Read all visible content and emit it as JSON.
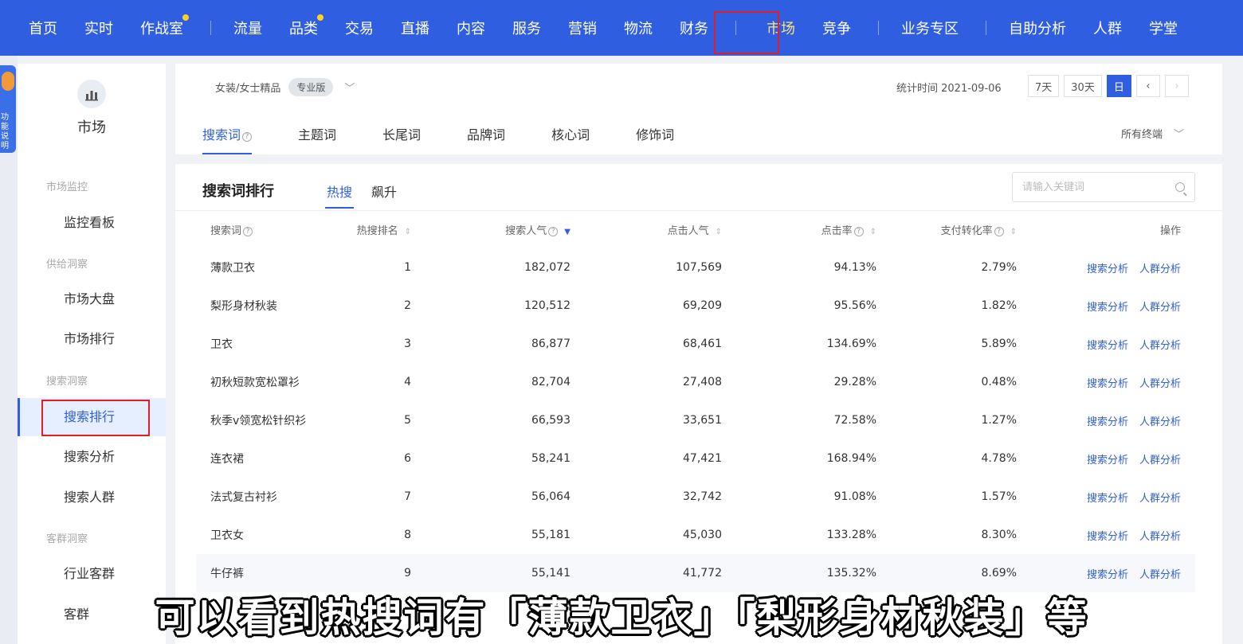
{
  "topnav": {
    "items": [
      "首页",
      "实时",
      "作战室",
      "流量",
      "品类",
      "交易",
      "直播",
      "内容",
      "服务",
      "营销",
      "物流",
      "财务",
      "市场",
      "竞争",
      "业务专区",
      "自助分析",
      "人群",
      "学堂"
    ],
    "active": "市场"
  },
  "mascot": {
    "text": "功能说明"
  },
  "sidebar": {
    "title": "市场",
    "group_monitor": "市场监控",
    "item_monitor_board": "监控看板",
    "group_supply": "供给洞察",
    "item_market_overview": "市场大盘",
    "item_market_rank": "市场排行",
    "group_search": "搜索洞察",
    "item_search_rank": "搜索排行",
    "item_search_analysis": "搜索分析",
    "item_search_crowd": "搜索人群",
    "group_customer": "客群洞察",
    "item_industry_crowd": "行业客群",
    "item_customer_partial": "客群"
  },
  "filter": {
    "category": "女装/女士精品",
    "edition": "专业版",
    "stat_time": "统计时间 2021-09-06",
    "range_7": "7天",
    "range_30": "30天",
    "range_day": "日",
    "prev": "‹",
    "next": "›",
    "tabs": [
      "搜索词",
      "主题词",
      "长尾词",
      "品牌词",
      "核心词",
      "修饰词"
    ],
    "terminal": "所有终端"
  },
  "ranking": {
    "title": "搜索词排行",
    "subtab_hot": "热搜",
    "subtab_rise": "飙升",
    "search_placeholder": "请输入关键词",
    "columns": [
      "搜索词",
      "热搜排名",
      "搜索人气",
      "点击人气",
      "点击率",
      "支付转化率",
      "操作"
    ],
    "link_search": "搜索分析",
    "link_crowd": "人群分析",
    "rows": [
      {
        "word": "薄款卫衣",
        "rank": "1",
        "search": "182,072",
        "click": "107,569",
        "ctr": "94.13%",
        "cvr": "2.79%"
      },
      {
        "word": "梨形身材秋装",
        "rank": "2",
        "search": "120,512",
        "click": "69,209",
        "ctr": "95.56%",
        "cvr": "1.82%"
      },
      {
        "word": "卫衣",
        "rank": "3",
        "search": "86,877",
        "click": "68,461",
        "ctr": "134.69%",
        "cvr": "5.89%"
      },
      {
        "word": "初秋短款宽松罩衫",
        "rank": "4",
        "search": "82,704",
        "click": "27,408",
        "ctr": "29.28%",
        "cvr": "0.48%"
      },
      {
        "word": "秋季v领宽松针织衫",
        "rank": "5",
        "search": "66,593",
        "click": "33,651",
        "ctr": "72.58%",
        "cvr": "1.27%"
      },
      {
        "word": "连衣裙",
        "rank": "6",
        "search": "58,241",
        "click": "47,421",
        "ctr": "168.94%",
        "cvr": "4.78%"
      },
      {
        "word": "法式复古衬衫",
        "rank": "7",
        "search": "56,064",
        "click": "32,742",
        "ctr": "91.08%",
        "cvr": "1.57%"
      },
      {
        "word": "卫衣女",
        "rank": "8",
        "search": "55,181",
        "click": "45,030",
        "ctr": "133.28%",
        "cvr": "8.30%"
      },
      {
        "word": "牛仔裤",
        "rank": "9",
        "search": "55,141",
        "click": "41,772",
        "ctr": "135.32%",
        "cvr": "8.69%"
      }
    ]
  },
  "caption": "可以看到热搜词有「薄款卫衣」「梨形身材秋装」等",
  "colors": {
    "primary": "#2f5fe0",
    "highlight": "#e11d2a"
  }
}
